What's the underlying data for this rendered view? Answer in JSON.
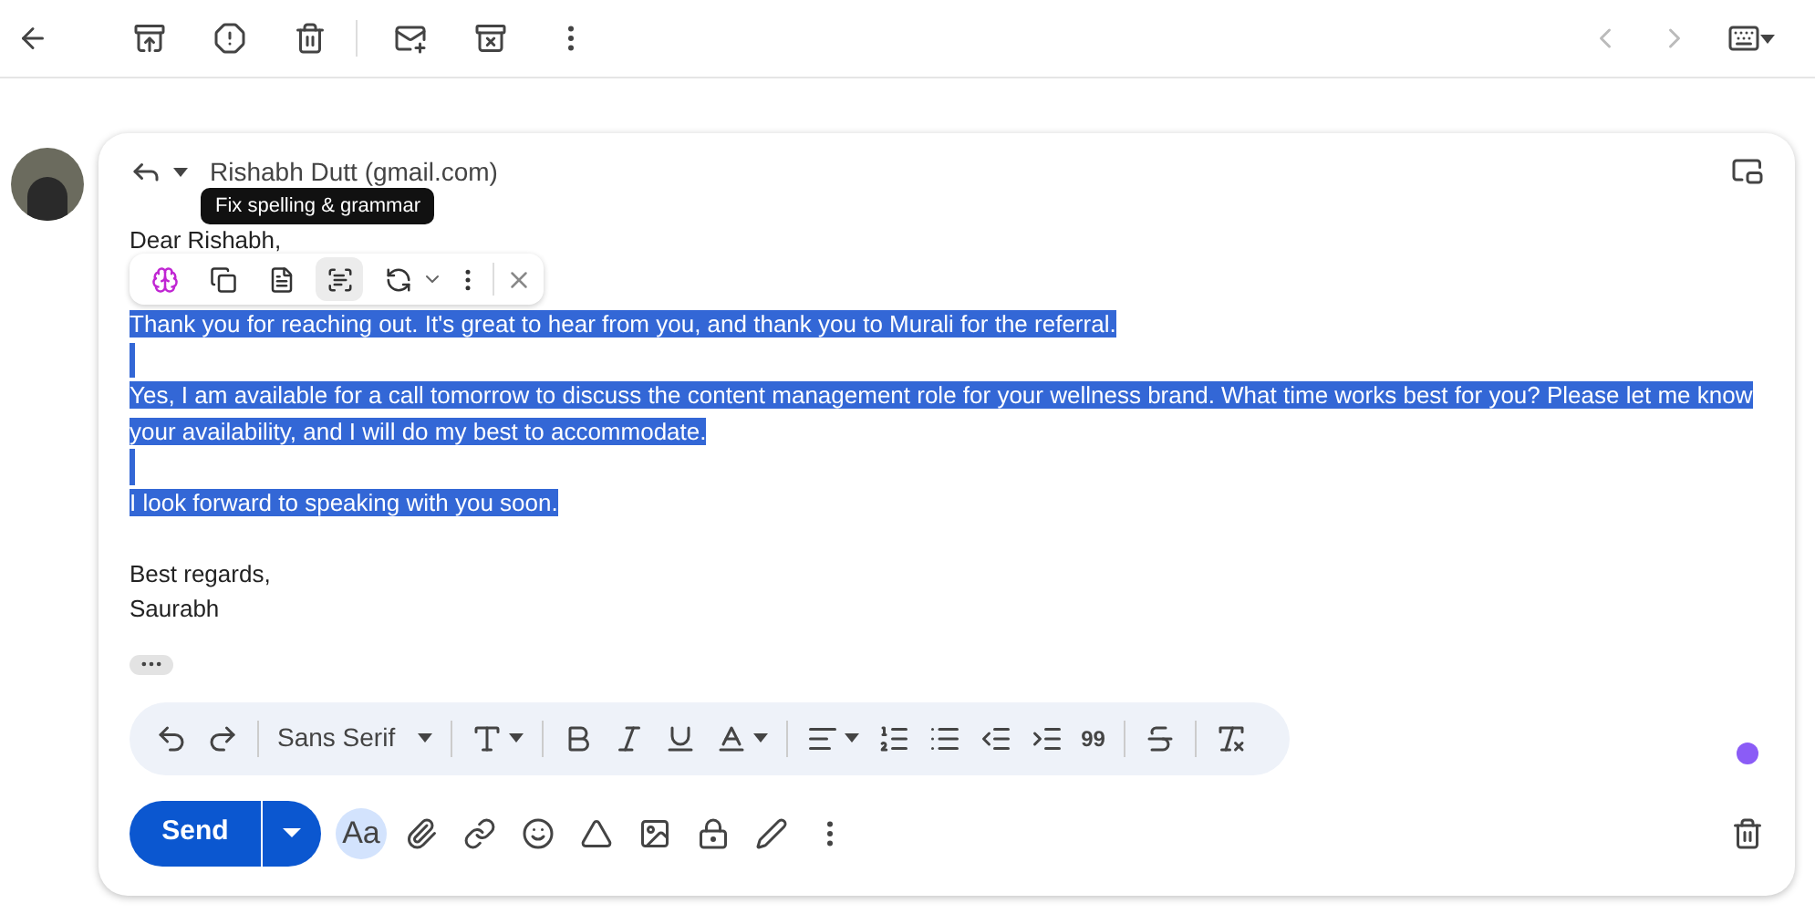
{
  "recipient": "Rishabh Dutt (gmail.com)",
  "tooltip": "Fix spelling & grammar",
  "greeting": "Dear Rishabh,",
  "body": [
    {
      "text": "Thank you for reaching out. It's great to hear from you, and thank you to Murali for the referral.",
      "selected": true
    },
    {
      "text": "Yes, I am available for a call tomorrow to discuss the content management role for your wellness brand. What time works best for you? Please let me know your availability, and I will do my best to accommodate.",
      "selected": true
    },
    {
      "text": "I look forward to speaking with you soon.",
      "selected": true
    }
  ],
  "signature": [
    "Best regards,",
    "Saurabh"
  ],
  "ai_toolbar": [
    {
      "kind": "brain",
      "selected": false
    },
    {
      "kind": "copy",
      "selected": false
    },
    {
      "kind": "rewrite",
      "selected": false
    },
    {
      "kind": "grammar",
      "selected": true
    },
    {
      "kind": "tone",
      "selected": false
    }
  ],
  "format_bar": {
    "font": "Sans Serif",
    "quote": "99"
  },
  "send_button": "Send",
  "formatting_toggle": {
    "label": "Aa",
    "selected": true
  },
  "status_dot": {
    "color": "#8b5cf6"
  }
}
